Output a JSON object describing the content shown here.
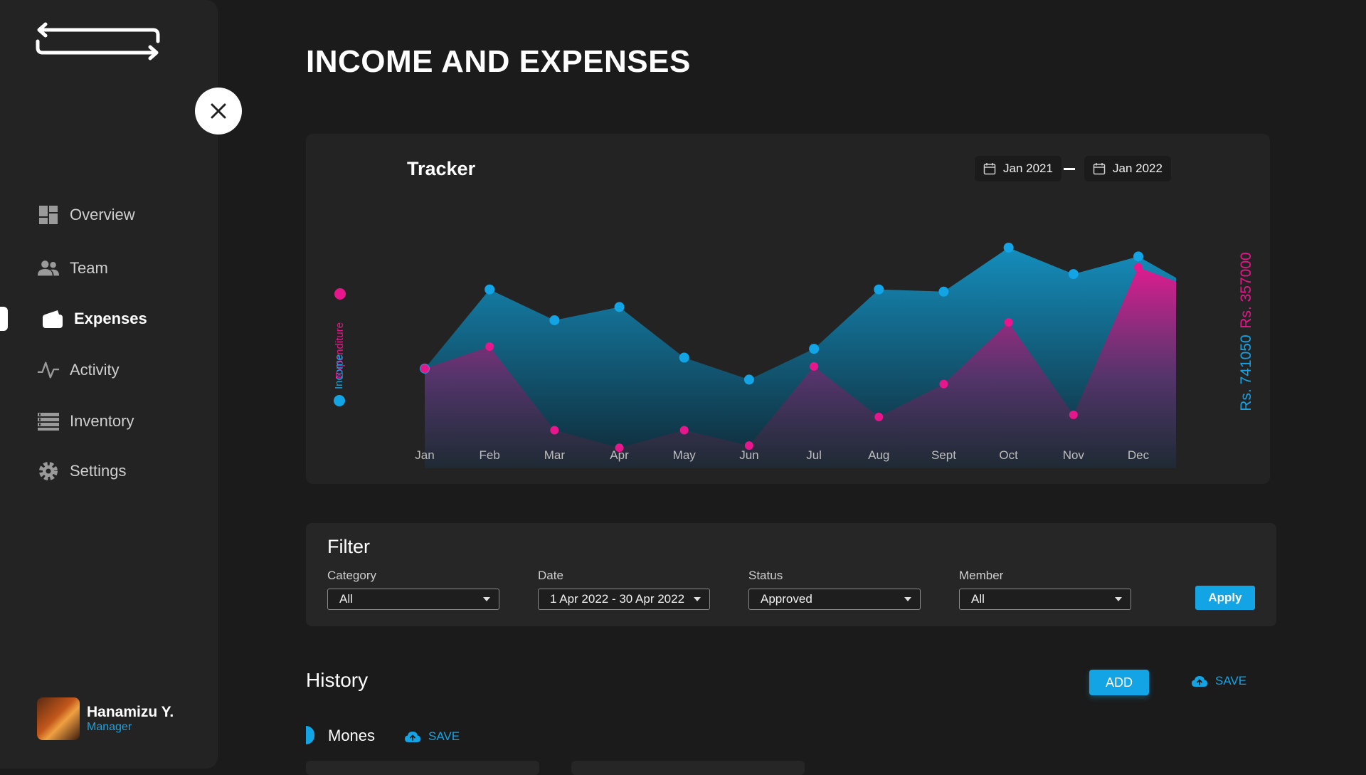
{
  "sidebar": {
    "items": [
      {
        "label": "Overview",
        "icon": "dashboard-icon"
      },
      {
        "label": "Team",
        "icon": "people-icon"
      },
      {
        "label": "Expenses",
        "icon": "wallet-icon"
      },
      {
        "label": "Activity",
        "icon": "pulse-icon"
      },
      {
        "label": "Inventory",
        "icon": "list-icon"
      },
      {
        "label": "Settings",
        "icon": "gear-icon"
      }
    ],
    "active_item": "Expenses",
    "profile": {
      "name": "Hanamizu Y.",
      "role": "Manager"
    }
  },
  "page": {
    "title": "INCOME AND EXPENSES"
  },
  "tracker": {
    "title": "Tracker",
    "date_from": "Jan 2021",
    "date_to": "Jan 2022"
  },
  "chart_data": {
    "type": "area",
    "categories": [
      "Jan",
      "Feb",
      "Mar",
      "Apr",
      "May",
      "Jun",
      "Jul",
      "Aug",
      "Sept",
      "Oct",
      "Nov",
      "Dec"
    ],
    "series": [
      {
        "name": "Income",
        "color": "#13a4e6",
        "values": [
          45,
          81,
          67,
          73,
          50,
          40,
          54,
          81,
          80,
          100,
          88,
          96
        ],
        "total_label": "Rs. 741050"
      },
      {
        "name": "Expenditure",
        "color": "#e8168c",
        "values": [
          45,
          55,
          17,
          9,
          17,
          10,
          46,
          23,
          38,
          66,
          24,
          91
        ],
        "total_label": "Rs. 357000"
      }
    ],
    "ylim": [
      0,
      100
    ],
    "grid": false,
    "legend": "left-vertical"
  },
  "filter": {
    "title": "Filter",
    "fields": [
      {
        "label": "Category",
        "value": "All"
      },
      {
        "label": "Date",
        "value": "1 Apr 2022 - 30 Apr 2022"
      },
      {
        "label": "Status",
        "value": "Approved"
      },
      {
        "label": "Member",
        "value": "All"
      }
    ],
    "apply_label": "Apply"
  },
  "history": {
    "title": "History",
    "add_label": "ADD",
    "save_label": "SAVE",
    "section": {
      "name": "Mones",
      "save_label": "SAVE"
    }
  },
  "colors": {
    "accent": "#13a4e6",
    "expense": "#e8168c",
    "background": "#1b1b1b",
    "panel": "#232323"
  }
}
